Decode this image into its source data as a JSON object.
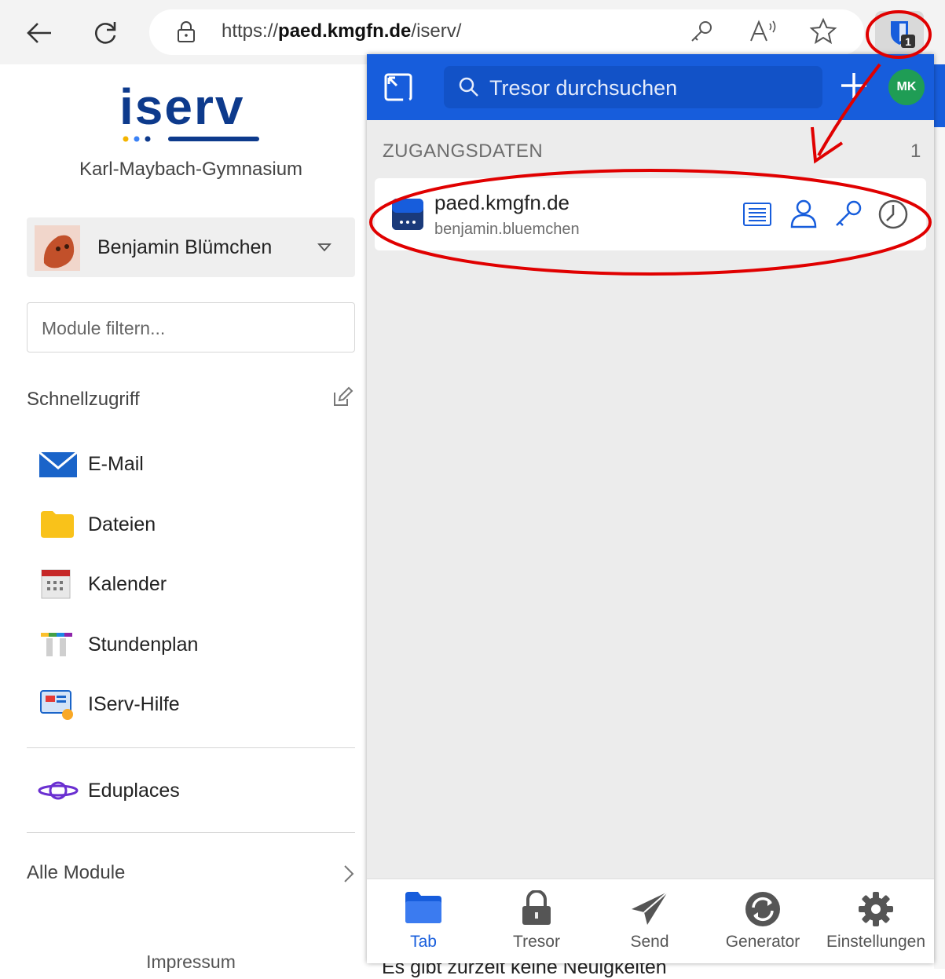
{
  "browser": {
    "url_prefix": "https://",
    "url_domain": "paed.kmgfn.de",
    "url_path": "/iserv/",
    "extension_badge": "1"
  },
  "sidebar": {
    "logo_text": "iserv",
    "school_name": "Karl-Maybach-Gymnasium",
    "user_name": "Benjamin Blümchen",
    "filter_placeholder": "Module filtern...",
    "quick_access_label": "Schnellzugriff",
    "modules": [
      {
        "label": "E-Mail",
        "icon": "mail-icon"
      },
      {
        "label": "Dateien",
        "icon": "folder-icon"
      },
      {
        "label": "Kalender",
        "icon": "calendar-icon"
      },
      {
        "label": "Stundenplan",
        "icon": "timetable-icon"
      },
      {
        "label": "IServ-Hilfe",
        "icon": "help-icon"
      }
    ],
    "eduplaces_label": "Eduplaces",
    "all_modules_label": "Alle Module",
    "impressum_label": "Impressum"
  },
  "background": {
    "news_text": "Es gibt zurzeit keine Neuigkeiten"
  },
  "popup": {
    "search_placeholder": "Tresor durchsuchen",
    "avatar_initials": "MK",
    "section_title": "ZUGANGSDATEN",
    "section_count": "1",
    "item": {
      "title": "paed.kmgfn.de",
      "username": "benjamin.bluemchen"
    },
    "tabs": [
      {
        "label": "Tab",
        "icon": "folder-icon"
      },
      {
        "label": "Tresor",
        "icon": "lock-icon"
      },
      {
        "label": "Send",
        "icon": "send-icon"
      },
      {
        "label": "Generator",
        "icon": "generator-icon"
      },
      {
        "label": "Einstellungen",
        "icon": "gear-icon"
      }
    ],
    "colors": {
      "primary": "#175ddc",
      "annotation": "#e00000"
    }
  }
}
